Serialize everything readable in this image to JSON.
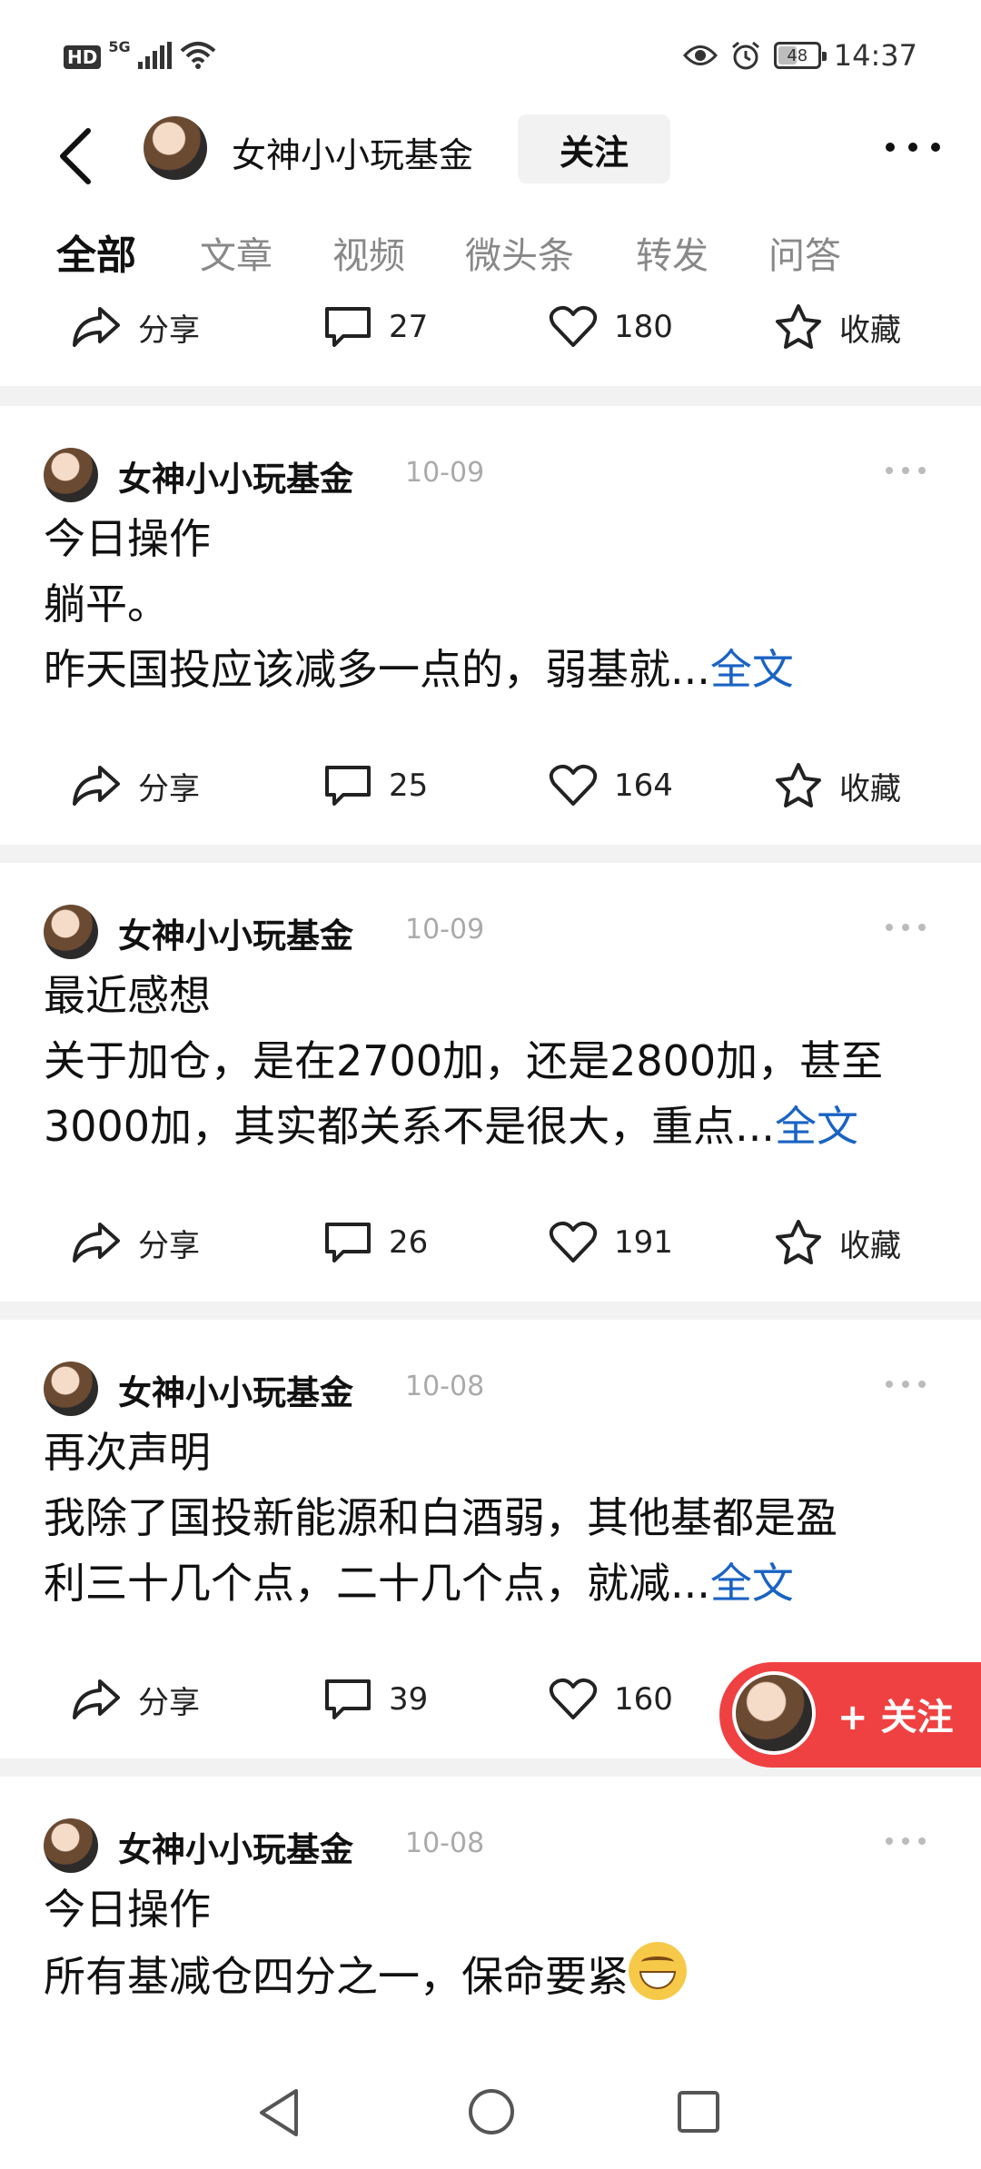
{
  "status_bar": {
    "hd": "HD",
    "network": "5G",
    "battery_level": 48,
    "time": "14:37"
  },
  "header": {
    "title": "女神小小玩基金",
    "follow_label": "关注"
  },
  "tabs": [
    "全部",
    "文章",
    "视频",
    "微头条",
    "转发",
    "问答"
  ],
  "top_actions": {
    "share": "分享",
    "comments": "27",
    "likes": "180",
    "favorite": "收藏"
  },
  "posts": [
    {
      "author": "女神小小玩基金",
      "date": "10-09",
      "lines": [
        "今日操作",
        "躺平。",
        "昨天国投应该减多一点的，弱基就..."
      ],
      "full_text": "全文",
      "share": "分享",
      "comments": "25",
      "likes": "164",
      "favorite": "收藏"
    },
    {
      "author": "女神小小玩基金",
      "date": "10-09",
      "lines": [
        "最近感想",
        "关于加仓，是在2700加，还是2800加，甚至",
        "3000加，其实都关系不是很大，重点..."
      ],
      "full_text": "全文",
      "share": "分享",
      "comments": "26",
      "likes": "191",
      "favorite": "收藏"
    },
    {
      "author": "女神小小玩基金",
      "date": "10-08",
      "lines": [
        "再次声明",
        "我除了国投新能源和白酒弱，其他基都是盈",
        "利三十几个点，二十几个点，就减..."
      ],
      "full_text": "全文",
      "share": "分享",
      "comments": "39",
      "likes": "160"
    },
    {
      "author": "女神小小玩基金",
      "date": "10-08",
      "lines": [
        "今日操作",
        "所有基减仓四分之一，保命要紧"
      ]
    }
  ],
  "floating_follow": {
    "label": "+ 关注"
  },
  "colors": {
    "link": "#1a63c4",
    "follow_red": "#f04142",
    "background": "#f2f2f2"
  }
}
